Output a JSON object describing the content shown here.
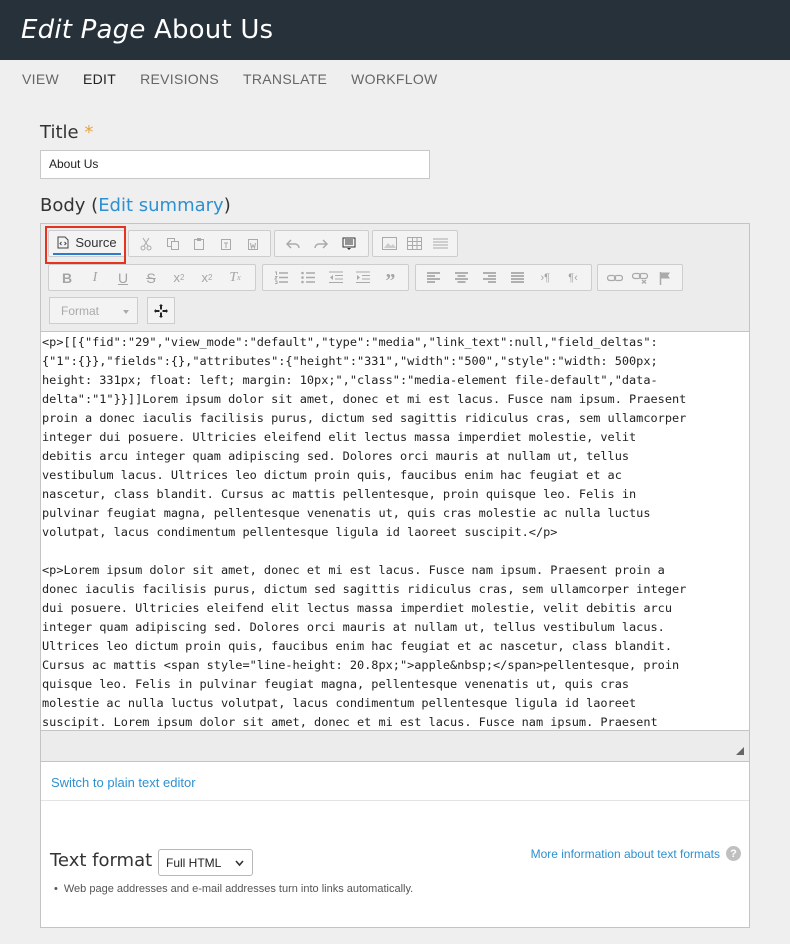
{
  "header": {
    "title_prefix": "Edit Page",
    "title_name": " About Us"
  },
  "tabs": [
    {
      "label": "VIEW"
    },
    {
      "label": "EDIT",
      "active": true
    },
    {
      "label": "REVISIONS"
    },
    {
      "label": "TRANSLATE"
    },
    {
      "label": "WORKFLOW"
    }
  ],
  "title_field": {
    "label": "Title",
    "required_mark": "*",
    "value": "About Us"
  },
  "body_field": {
    "label": "Body (",
    "link": "Edit summary",
    "label_end": ")"
  },
  "toolbar": {
    "source_label": "Source",
    "format_label": "Format",
    "icons": [
      "source-icon",
      "cut-icon",
      "copy-icon",
      "paste-icon",
      "paste-text-icon",
      "paste-word-icon",
      "undo-icon",
      "redo-icon",
      "show-blocks-icon",
      "image-icon",
      "table-icon",
      "horizontal-rule-icon",
      "bold-icon",
      "italic-icon",
      "underline-icon",
      "strikethrough-icon",
      "subscript-icon",
      "superscript-icon",
      "remove-format-icon",
      "numbered-list-icon",
      "bulleted-list-icon",
      "outdent-icon",
      "indent-icon",
      "blockquote-icon",
      "align-left-icon",
      "align-center-icon",
      "align-right-icon",
      "justify-icon",
      "ltr-icon",
      "rtl-icon",
      "link-icon",
      "unlink-icon",
      "anchor-icon",
      "maximize-icon"
    ]
  },
  "source_lines": [
    "<p>[[{\"fid\":\"29\",\"view_mode\":\"default\",\"type\":\"media\",\"link_text\":null,\"field_deltas\":",
    "{\"1\":{}},\"fields\":{},\"attributes\":{\"height\":\"331\",\"width\":\"500\",\"style\":\"width: 500px;",
    "height: 331px; float: left; margin: 10px;\",\"class\":\"media-element file-default\",\"data-",
    "delta\":\"1\"}}]]Lorem ipsum dolor sit amet, donec et mi est lacus. Fusce nam ipsum. Praesent",
    "proin a donec iaculis facilisis purus, dictum sed sagittis ridiculus cras, sem ullamcorper",
    "integer dui posuere. Ultricies eleifend elit lectus massa imperdiet molestie, velit",
    "debitis arcu integer quam adipiscing sed. Dolores orci mauris at nullam ut, tellus",
    "vestibulum lacus. Ultrices leo dictum proin quis, faucibus enim hac feugiat et ac",
    "nascetur, class blandit. Cursus ac mattis pellentesque, proin quisque leo. Felis in",
    "pulvinar feugiat magna, pellentesque venenatis ut, quis cras molestie ac nulla luctus",
    "volutpat, lacus condimentum pellentesque ligula id laoreet suscipit.</p>",
    "",
    "<p>Lorem ipsum dolor sit amet, donec et mi est lacus. Fusce nam ipsum. Praesent proin a",
    "donec iaculis facilisis purus, dictum sed sagittis ridiculus cras, sem ullamcorper integer",
    "dui posuere. Ultricies eleifend elit lectus massa imperdiet molestie, velit debitis arcu",
    "integer quam adipiscing sed. Dolores orci mauris at nullam ut, tellus vestibulum lacus.",
    "Ultrices leo dictum proin quis, faucibus enim hac feugiat et ac nascetur, class blandit.",
    "Cursus ac mattis <span style=\"line-height: 20.8px;\">apple&nbsp;</span>pellentesque, proin",
    "quisque leo. Felis in pulvinar feugiat magna, pellentesque venenatis ut, quis cras",
    "molestie ac nulla luctus volutpat, lacus condimentum pellentesque ligula id laoreet",
    "suscipit. Lorem ipsum dolor sit amet, donec et mi est lacus. Fusce nam ipsum. Praesent"
  ],
  "switch_editor": "Switch to plain text editor",
  "text_format": {
    "label": "Text format",
    "selected": "Full HTML",
    "more_info": "More information about text formats",
    "help_symbol": "?",
    "tip": "Web page addresses and e-mail addresses turn into links automatically."
  },
  "colors": {
    "header_bg": "#27313a",
    "link": "#2e90d0",
    "required": "#e8a23f",
    "highlight": "#e8321e"
  }
}
